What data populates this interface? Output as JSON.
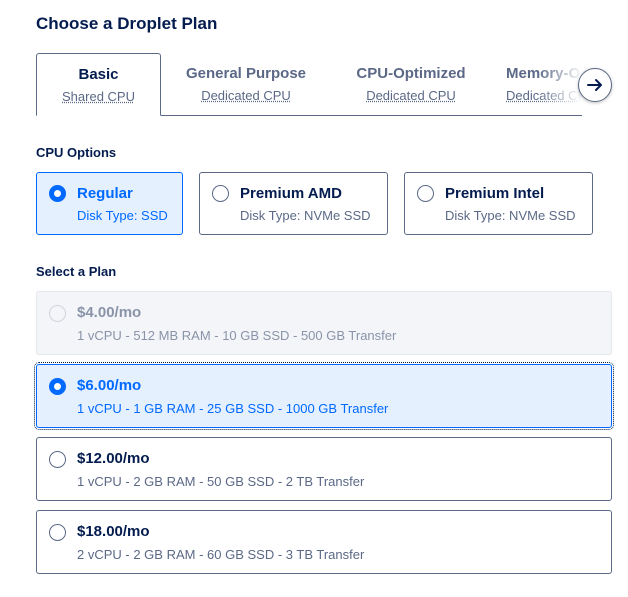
{
  "title": "Choose a Droplet Plan",
  "tabs": [
    {
      "name": "Basic",
      "sub": "Shared CPU"
    },
    {
      "name": "General Purpose",
      "sub": "Dedicated CPU"
    },
    {
      "name": "CPU-Optimized",
      "sub": "Dedicated CPU"
    },
    {
      "name": "Memory-Optimized",
      "sub": "Dedicated CPU"
    }
  ],
  "cpu_options": {
    "label": "CPU Options",
    "items": [
      {
        "name": "Regular",
        "sub": "Disk Type: SSD"
      },
      {
        "name": "Premium AMD",
        "sub": "Disk Type: NVMe SSD"
      },
      {
        "name": "Premium Intel",
        "sub": "Disk Type: NVMe SSD"
      }
    ]
  },
  "plans": {
    "label": "Select a Plan",
    "items": [
      {
        "price": "$4.00",
        "per": "/mo",
        "specs": "1 vCPU - 512 MB RAM - 10 GB SSD - 500 GB Transfer"
      },
      {
        "price": "$6.00",
        "per": "/mo",
        "specs": "1 vCPU - 1 GB RAM - 25 GB SSD - 1000 GB Transfer"
      },
      {
        "price": "$12.00",
        "per": "/mo",
        "specs": "1 vCPU - 2 GB RAM - 50 GB SSD - 2 TB Transfer"
      },
      {
        "price": "$18.00",
        "per": "/mo",
        "specs": "2 vCPU - 2 GB RAM - 60 GB SSD - 3 TB Transfer"
      }
    ]
  },
  "colors": {
    "accent": "#0069ff",
    "text": "#031b4e",
    "muted": "#5b6987",
    "selected_bg": "#e5f0ff"
  },
  "icons": {
    "scroll": "arrow-right-icon"
  }
}
